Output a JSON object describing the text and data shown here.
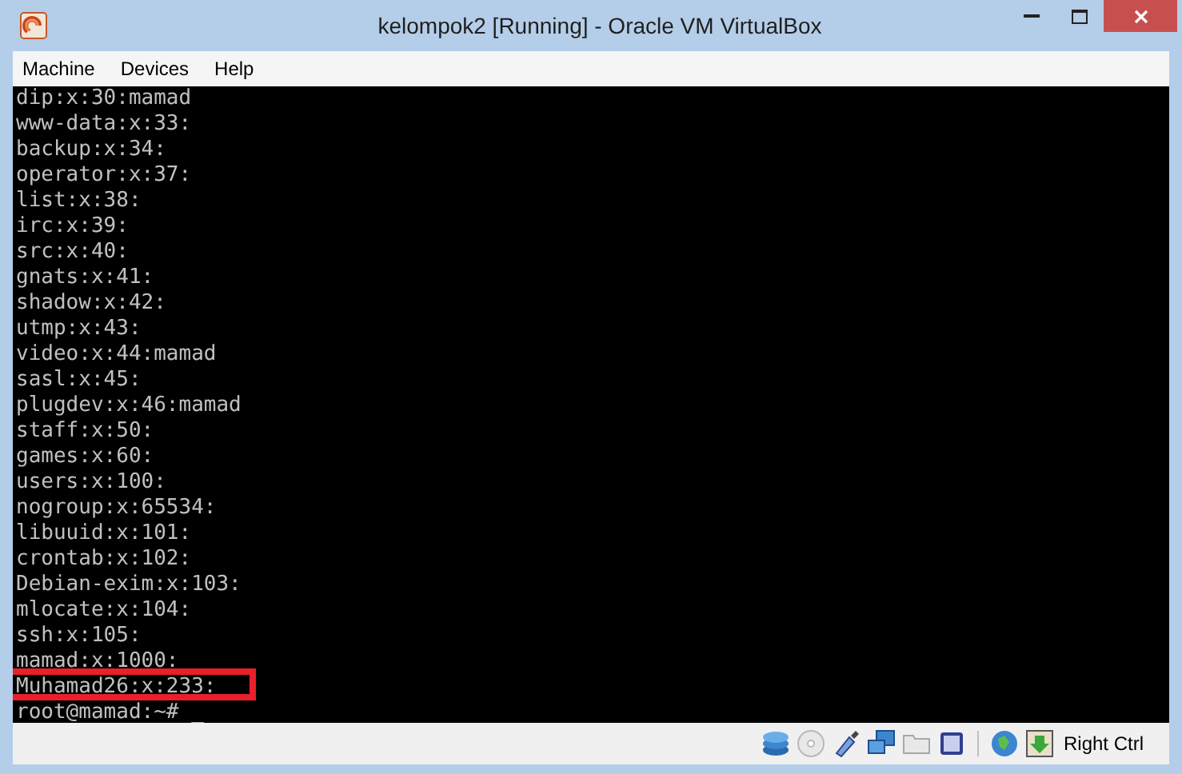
{
  "window": {
    "title": "kelompok2 [Running] - Oracle VM VirtualBox"
  },
  "menu": [
    "Machine",
    "Devices",
    "Help"
  ],
  "terminal": {
    "lines": [
      {
        "text": "dip:x:30:mamad",
        "highlighted": false
      },
      {
        "text": "www-data:x:33:",
        "highlighted": false
      },
      {
        "text": "backup:x:34:",
        "highlighted": false
      },
      {
        "text": "operator:x:37:",
        "highlighted": false
      },
      {
        "text": "list:x:38:",
        "highlighted": false
      },
      {
        "text": "irc:x:39:",
        "highlighted": false
      },
      {
        "text": "src:x:40:",
        "highlighted": false
      },
      {
        "text": "gnats:x:41:",
        "highlighted": false
      },
      {
        "text": "shadow:x:42:",
        "highlighted": false
      },
      {
        "text": "utmp:x:43:",
        "highlighted": false
      },
      {
        "text": "video:x:44:mamad",
        "highlighted": false
      },
      {
        "text": "sasl:x:45:",
        "highlighted": false
      },
      {
        "text": "plugdev:x:46:mamad",
        "highlighted": false
      },
      {
        "text": "staff:x:50:",
        "highlighted": false
      },
      {
        "text": "games:x:60:",
        "highlighted": false
      },
      {
        "text": "users:x:100:",
        "highlighted": false
      },
      {
        "text": "nogroup:x:65534:",
        "highlighted": false
      },
      {
        "text": "libuuid:x:101:",
        "highlighted": false
      },
      {
        "text": "crontab:x:102:",
        "highlighted": false
      },
      {
        "text": "Debian-exim:x:103:",
        "highlighted": false
      },
      {
        "text": "mlocate:x:104:",
        "highlighted": false
      },
      {
        "text": "ssh:x:105:",
        "highlighted": false
      },
      {
        "text": "mamad:x:1000:",
        "highlighted": false
      },
      {
        "text": "Muhamad26:x:233:",
        "highlighted": true
      },
      {
        "text": "root@mamad:~# _",
        "highlighted": false
      }
    ]
  },
  "status_bar": {
    "shortcut": "Right Ctrl"
  }
}
